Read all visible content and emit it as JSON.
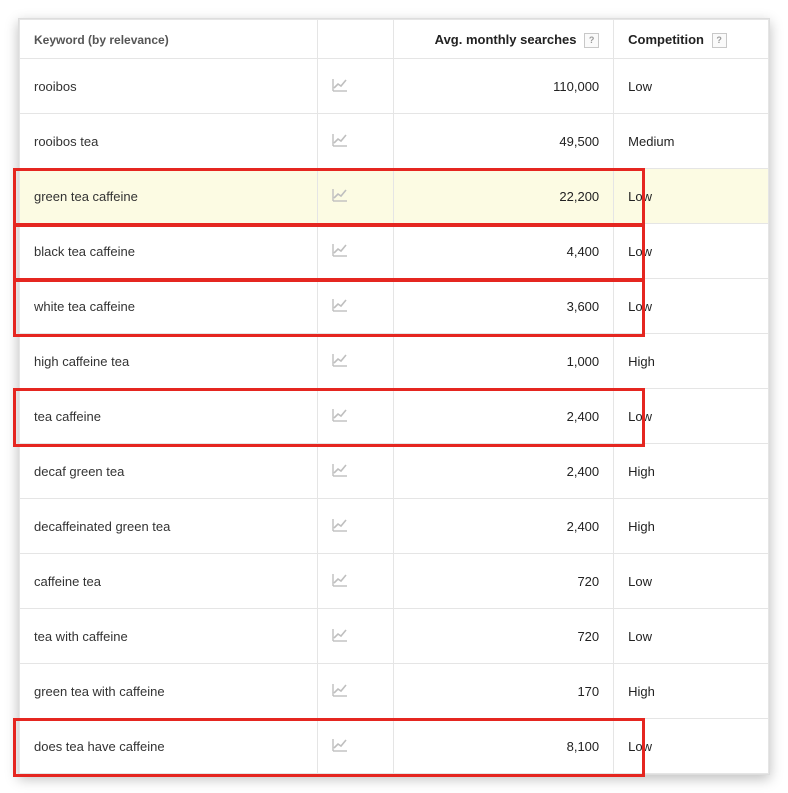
{
  "header": {
    "keyword_col": "Keyword (by relevance)",
    "searches_col": "Avg. monthly searches",
    "competition_col": "Competition"
  },
  "rows": [
    {
      "keyword": "rooibos",
      "searches": "110,000",
      "competition": "Low",
      "boxed": false,
      "highlighted": false
    },
    {
      "keyword": "rooibos tea",
      "searches": "49,500",
      "competition": "Medium",
      "boxed": false,
      "highlighted": false
    },
    {
      "keyword": "green tea caffeine",
      "searches": "22,200",
      "competition": "Low",
      "boxed": true,
      "highlighted": true
    },
    {
      "keyword": "black tea caffeine",
      "searches": "4,400",
      "competition": "Low",
      "boxed": true,
      "highlighted": false
    },
    {
      "keyword": "white tea caffeine",
      "searches": "3,600",
      "competition": "Low",
      "boxed": true,
      "highlighted": false
    },
    {
      "keyword": "high caffeine tea",
      "searches": "1,000",
      "competition": "High",
      "boxed": false,
      "highlighted": false
    },
    {
      "keyword": "tea caffeine",
      "searches": "2,400",
      "competition": "Low",
      "boxed": true,
      "highlighted": false
    },
    {
      "keyword": "decaf green tea",
      "searches": "2,400",
      "competition": "High",
      "boxed": false,
      "highlighted": false
    },
    {
      "keyword": "decaffeinated green tea",
      "searches": "2,400",
      "competition": "High",
      "boxed": false,
      "highlighted": false
    },
    {
      "keyword": "caffeine tea",
      "searches": "720",
      "competition": "Low",
      "boxed": false,
      "highlighted": false
    },
    {
      "keyword": "tea with caffeine",
      "searches": "720",
      "competition": "Low",
      "boxed": false,
      "highlighted": false
    },
    {
      "keyword": "green tea with caffeine",
      "searches": "170",
      "competition": "High",
      "boxed": false,
      "highlighted": false
    },
    {
      "keyword": "does tea have caffeine",
      "searches": "8,100",
      "competition": "Low",
      "boxed": true,
      "highlighted": false
    }
  ]
}
